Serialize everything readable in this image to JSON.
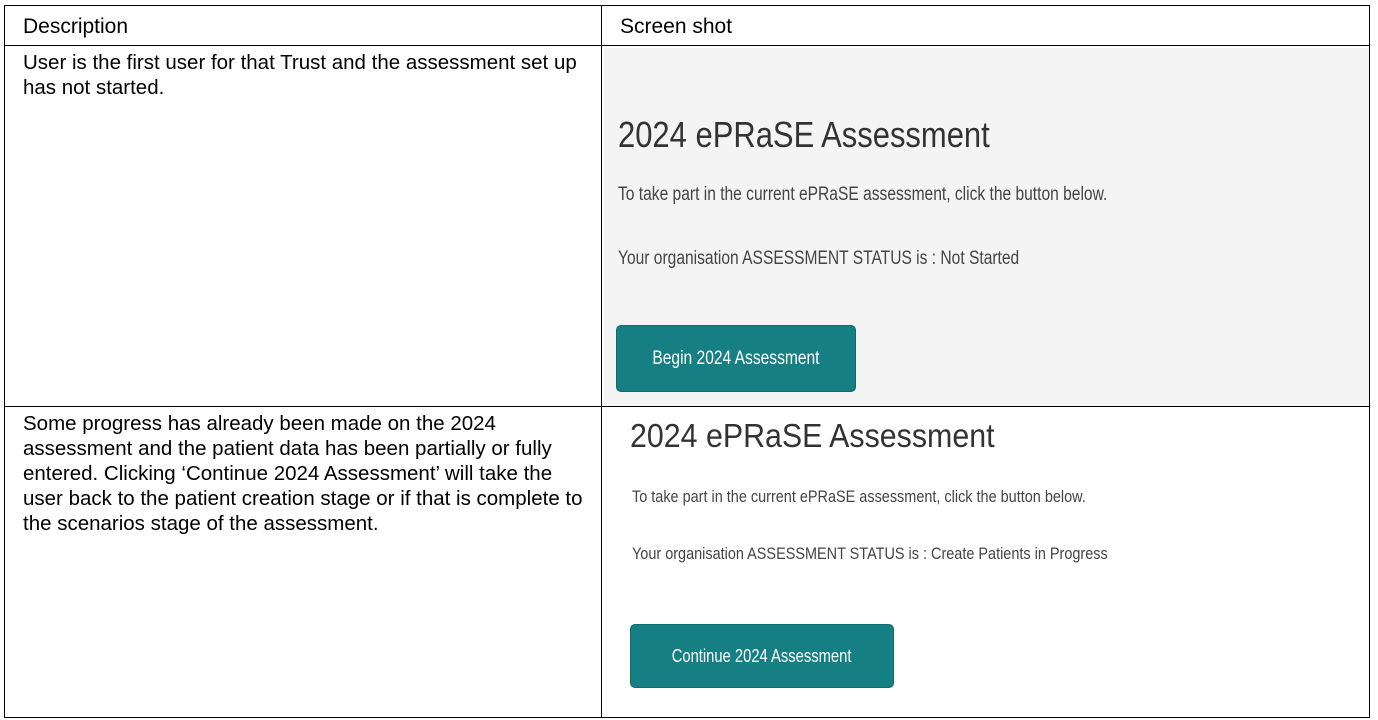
{
  "table": {
    "headers": [
      "Description",
      "Screen shot"
    ],
    "rows": [
      {
        "description": "User is the first user for that Trust and the assessment set up has not started.",
        "screenshot": {
          "heading": "2024 ePRaSE Assessment",
          "instruction": "To take part in the current ePRaSE assessment, click the button below.",
          "status": "Your organisation ASSESSMENT STATUS is : Not Started",
          "button_label": "Begin 2024 Assessment"
        }
      },
      {
        "description": "Some progress has already been made on the 2024 assessment and the patient data has been partially or fully entered. Clicking ‘Continue 2024 Assessment’ will take the user back to the patient creation stage or if that is complete to the scenarios stage of the assessment.",
        "screenshot": {
          "heading": "2024 ePRaSE Assessment",
          "instruction": "To take part in the current ePRaSE assessment, click the button below.",
          "status": "Your organisation ASSESSMENT STATUS is : Create Patients in Progress",
          "button_label": "Continue 2024 Assessment"
        }
      }
    ]
  },
  "colors": {
    "button_bg": "#167f83",
    "panel_bg": "#f4f4f4"
  }
}
